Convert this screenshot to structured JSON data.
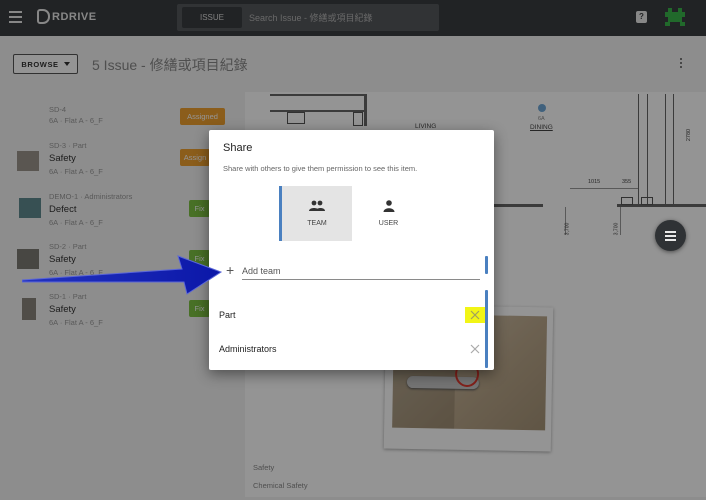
{
  "topbar": {
    "logo_text": "RDRIVE",
    "search_chip": "ISSUE",
    "search_placeholder": "Search Issue - 修繕或項目紀錄",
    "help_glyph": "?"
  },
  "header": {
    "browse_label": "BROWSE",
    "title": "5 Issue - 修繕或項目紀錄"
  },
  "issues": [
    {
      "meta": "SD-4",
      "name": "",
      "loc": "6A · Flat A - 6_F",
      "status": "Assigned",
      "status_color": "#f0a030"
    },
    {
      "meta": "SD-3 · Part",
      "name": "Safety",
      "loc": "6A · Flat A - 6_F",
      "status": "Assign",
      "status_color": "#f0a030"
    },
    {
      "meta": "DEMO-1 · Administrators",
      "name": "Defect",
      "loc": "6A · Flat A - 6_F",
      "status": "Fix",
      "status_color": "#7cc242"
    },
    {
      "meta": "SD-2 · Part",
      "name": "Safety",
      "loc": "6A · Flat A - 6_F",
      "status": "Fix",
      "status_color": "#7cc242"
    },
    {
      "meta": "SD-1 · Part",
      "name": "Safety",
      "loc": "6A · Flat A - 6_F",
      "status": "Fix",
      "status_color": "#7cc242"
    }
  ],
  "plan": {
    "labels": [
      "LIVING",
      "DINING",
      "6A"
    ],
    "dims": [
      "1015",
      "355",
      "2780",
      "3,700",
      "3,700"
    ],
    "caption_1": "Safety",
    "caption_2": "Chemical Safety"
  },
  "dialog": {
    "title": "Share",
    "description": "Share with others to give them permission to see this item.",
    "toggle_team": "TEAM",
    "toggle_user": "USER",
    "add_plus": "+",
    "add_placeholder": "Add team",
    "teams": [
      {
        "name": "Part",
        "highlighted": true
      },
      {
        "name": "Administrators",
        "highlighted": false
      }
    ]
  },
  "colors": {
    "topbar": "#3a3d40",
    "accent_blue": "#4a80c0",
    "assigned": "#f0a030",
    "fixed": "#7cc242",
    "highlight": "#f2f516",
    "arrow": "#1f2fb8"
  },
  "icons": [
    "menu-icon",
    "rdrive-logo",
    "help-icon",
    "avatar-icon",
    "caret-down-icon",
    "more-vert-icon",
    "team-icon",
    "user-icon",
    "plus-icon",
    "close-icon",
    "list-icon"
  ]
}
